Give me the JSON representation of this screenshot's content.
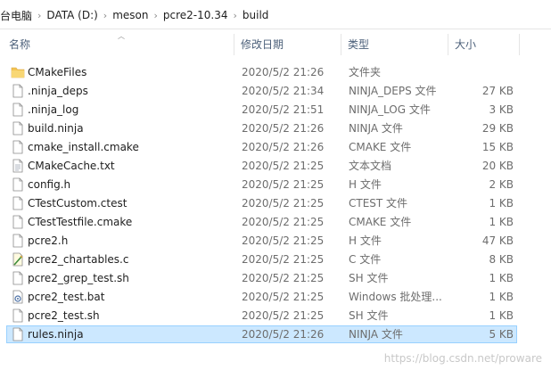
{
  "breadcrumb": {
    "items": [
      "台电脑",
      "DATA (D:)",
      "meson",
      "pcre2-10.34",
      "build"
    ]
  },
  "columns": {
    "name": "名称",
    "date": "修改日期",
    "type": "类型",
    "size": "大小"
  },
  "files": [
    {
      "name": "CMakeFiles",
      "date": "2020/5/2 21:26",
      "type": "文件夹",
      "size": "",
      "icon": "folder-icon"
    },
    {
      "name": ".ninja_deps",
      "date": "2020/5/2 21:34",
      "type": "NINJA_DEPS 文件",
      "size": "27 KB",
      "icon": "file-icon"
    },
    {
      "name": ".ninja_log",
      "date": "2020/5/2 21:51",
      "type": "NINJA_LOG 文件",
      "size": "3 KB",
      "icon": "file-icon"
    },
    {
      "name": "build.ninja",
      "date": "2020/5/2 21:26",
      "type": "NINJA 文件",
      "size": "29 KB",
      "icon": "file-icon"
    },
    {
      "name": "cmake_install.cmake",
      "date": "2020/5/2 21:26",
      "type": "CMAKE 文件",
      "size": "15 KB",
      "icon": "file-icon"
    },
    {
      "name": "CMakeCache.txt",
      "date": "2020/5/2 21:25",
      "type": "文本文档",
      "size": "20 KB",
      "icon": "text-file-icon"
    },
    {
      "name": "config.h",
      "date": "2020/5/2 21:25",
      "type": "H 文件",
      "size": "2 KB",
      "icon": "file-icon"
    },
    {
      "name": "CTestCustom.ctest",
      "date": "2020/5/2 21:25",
      "type": "CTEST 文件",
      "size": "1 KB",
      "icon": "file-icon"
    },
    {
      "name": "CTestTestfile.cmake",
      "date": "2020/5/2 21:25",
      "type": "CMAKE 文件",
      "size": "1 KB",
      "icon": "file-icon"
    },
    {
      "name": "pcre2.h",
      "date": "2020/5/2 21:25",
      "type": "H 文件",
      "size": "47 KB",
      "icon": "file-icon"
    },
    {
      "name": "pcre2_chartables.c",
      "date": "2020/5/2 21:25",
      "type": "C 文件",
      "size": "8 KB",
      "icon": "c-source-icon"
    },
    {
      "name": "pcre2_grep_test.sh",
      "date": "2020/5/2 21:25",
      "type": "SH 文件",
      "size": "1 KB",
      "icon": "file-icon"
    },
    {
      "name": "pcre2_test.bat",
      "date": "2020/5/2 21:25",
      "type": "Windows 批处理...",
      "size": "1 KB",
      "icon": "batch-file-icon"
    },
    {
      "name": "pcre2_test.sh",
      "date": "2020/5/2 21:25",
      "type": "SH 文件",
      "size": "1 KB",
      "icon": "file-icon"
    },
    {
      "name": "rules.ninja",
      "date": "2020/5/2 21:26",
      "type": "NINJA 文件",
      "size": "5 KB",
      "icon": "file-icon",
      "selected": true
    }
  ],
  "watermark": "https://blog.csdn.net/proware",
  "colors": {
    "header_text": "#4c607a",
    "selection_fill": "#cce8ff",
    "selection_border": "#99d1ff",
    "folder": "#f3c454"
  }
}
